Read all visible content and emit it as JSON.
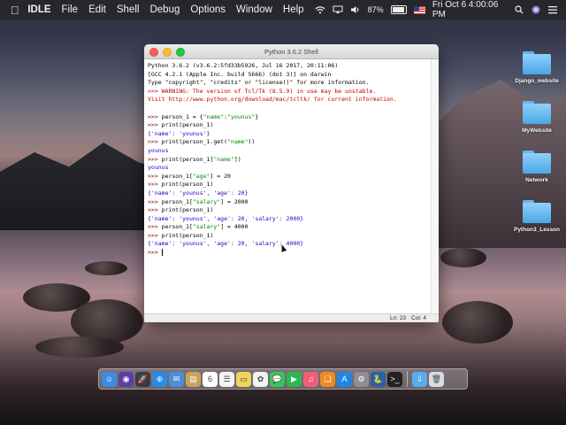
{
  "menubar": {
    "app_name": "IDLE",
    "menus": [
      "File",
      "Edit",
      "Shell",
      "Debug",
      "Options",
      "Window",
      "Help"
    ],
    "battery": "87%",
    "clock": "Fri Oct 6  4:00:06 PM",
    "icons": [
      "apple-icon",
      "wifi-icon",
      "airplay-icon",
      "volume-icon",
      "battery-icon",
      "flag-icon",
      "search-icon",
      "siri-icon",
      "list-icon"
    ]
  },
  "desktop": {
    "icons": [
      {
        "label": "Django_website",
        "icon": "folder-icon"
      },
      {
        "label": "MyWebsite",
        "icon": "folder-icon"
      },
      {
        "label": "Network",
        "icon": "folder-icon"
      },
      {
        "label": "Python3_Lesson",
        "icon": "folder-icon"
      }
    ]
  },
  "window": {
    "title": "Python 3.6.2 Shell",
    "lines": [
      [
        {
          "t": "Python 3.6.2 (v3.6.2:5fd33b5926, Jul 16 2017, 20:11:06)",
          "c": "out"
        }
      ],
      [
        {
          "t": "[GCC 4.2.1 (Apple Inc. build 5666) (dot 3)] on darwin",
          "c": "out"
        }
      ],
      [
        {
          "t": "Type \"copyright\", \"credits\" or \"license()\" for more information.",
          "c": "out"
        }
      ],
      [
        {
          "t": ">>> WARNING: The version of Tcl/Tk (8.5.9) in use may be unstable.",
          "c": "warn"
        }
      ],
      [
        {
          "t": "Visit http://www.python.org/download/mac/tcltk/ for current information.",
          "c": "warn"
        }
      ],
      [
        {
          "t": "",
          "c": "out"
        }
      ],
      [
        {
          "t": ">>> ",
          "c": "prompt"
        },
        {
          "t": "person_1 = {",
          "c": "code"
        },
        {
          "t": "\"name\"",
          "c": "str"
        },
        {
          "t": ":",
          "c": "code"
        },
        {
          "t": "\"younus\"",
          "c": "str"
        },
        {
          "t": "}",
          "c": "code"
        }
      ],
      [
        {
          "t": ">>> ",
          "c": "prompt"
        },
        {
          "t": "print(person_1)",
          "c": "code"
        }
      ],
      [
        {
          "t": "{'name': 'younus'}",
          "c": "stdout"
        }
      ],
      [
        {
          "t": ">>> ",
          "c": "prompt"
        },
        {
          "t": "print(person_1.get(",
          "c": "code"
        },
        {
          "t": "\"name\"",
          "c": "str"
        },
        {
          "t": "))",
          "c": "code"
        }
      ],
      [
        {
          "t": "younus",
          "c": "stdout"
        }
      ],
      [
        {
          "t": ">>> ",
          "c": "prompt"
        },
        {
          "t": "print(person_1[",
          "c": "code"
        },
        {
          "t": "\"name\"",
          "c": "str"
        },
        {
          "t": "])",
          "c": "code"
        }
      ],
      [
        {
          "t": "younus",
          "c": "stdout"
        }
      ],
      [
        {
          "t": ">>> ",
          "c": "prompt"
        },
        {
          "t": "person_1[",
          "c": "code"
        },
        {
          "t": "\"age\"",
          "c": "str"
        },
        {
          "t": "] = 20",
          "c": "code"
        }
      ],
      [
        {
          "t": ">>> ",
          "c": "prompt"
        },
        {
          "t": "print(person_1)",
          "c": "code"
        }
      ],
      [
        {
          "t": "{'name': 'younus', 'age': 20}",
          "c": "stdout"
        }
      ],
      [
        {
          "t": ">>> ",
          "c": "prompt"
        },
        {
          "t": "person_1[",
          "c": "code"
        },
        {
          "t": "\"salary\"",
          "c": "str"
        },
        {
          "t": "] = 2000",
          "c": "code"
        }
      ],
      [
        {
          "t": ">>> ",
          "c": "prompt"
        },
        {
          "t": "print(person_1)",
          "c": "code"
        }
      ],
      [
        {
          "t": "{'name': 'younus', 'age': 20, 'salary': 2000}",
          "c": "stdout"
        }
      ],
      [
        {
          "t": ">>> ",
          "c": "prompt"
        },
        {
          "t": "person_1[",
          "c": "code"
        },
        {
          "t": "\"salary\"",
          "c": "str"
        },
        {
          "t": "] = 4000",
          "c": "code"
        }
      ],
      [
        {
          "t": ">>> ",
          "c": "prompt"
        },
        {
          "t": "print(person_1)",
          "c": "code"
        }
      ],
      [
        {
          "t": "{'name': 'younus', 'age': 20, 'salary': 4000}",
          "c": "stdout"
        }
      ],
      [
        {
          "t": ">>> ",
          "c": "prompt"
        }
      ]
    ],
    "status": {
      "line": "Ln: 23",
      "col": "Col: 4"
    }
  },
  "dock": {
    "apps": [
      {
        "name": "finder-icon",
        "color": "#3d8ae0",
        "glyph": "☺"
      },
      {
        "name": "siri-icon",
        "color": "#5a3fa8",
        "glyph": "◉"
      },
      {
        "name": "launchpad-icon",
        "color": "#3b3b44",
        "glyph": "🚀"
      },
      {
        "name": "safari-icon",
        "color": "#2a8ae8",
        "glyph": "⊕"
      },
      {
        "name": "mail-icon",
        "color": "#4c8fd9",
        "glyph": "✉"
      },
      {
        "name": "notes-icon",
        "color": "#c9a35a",
        "glyph": "▤"
      },
      {
        "name": "calendar-icon",
        "color": "#ffffff",
        "glyph": "6"
      },
      {
        "name": "reminders-icon",
        "color": "#f4f4f4",
        "glyph": "☰"
      },
      {
        "name": "stickies-icon",
        "color": "#f1d35c",
        "glyph": "▭"
      },
      {
        "name": "photos-icon",
        "color": "#f3f3f3",
        "glyph": "✿"
      },
      {
        "name": "messages-icon",
        "color": "#35c759",
        "glyph": "💬"
      },
      {
        "name": "facetime-icon",
        "color": "#2cb84c",
        "glyph": "▶"
      },
      {
        "name": "music-icon",
        "color": "#f45d7a",
        "glyph": "♫"
      },
      {
        "name": "ibooks-icon",
        "color": "#f08a24",
        "glyph": "❏"
      },
      {
        "name": "appstore-icon",
        "color": "#1f86e8",
        "glyph": "A"
      },
      {
        "name": "preferences-icon",
        "color": "#8e8e93",
        "glyph": "⚙"
      },
      {
        "name": "idle-icon",
        "color": "#2f5f9e",
        "glyph": "🐍"
      },
      {
        "name": "terminal-icon",
        "color": "#222222",
        "glyph": ">_"
      },
      {
        "name": "downloads-folder-icon",
        "color": "#58aeea",
        "glyph": "⇩"
      },
      {
        "name": "trash-icon",
        "color": "#d9dde2",
        "glyph": "🗑"
      }
    ]
  }
}
